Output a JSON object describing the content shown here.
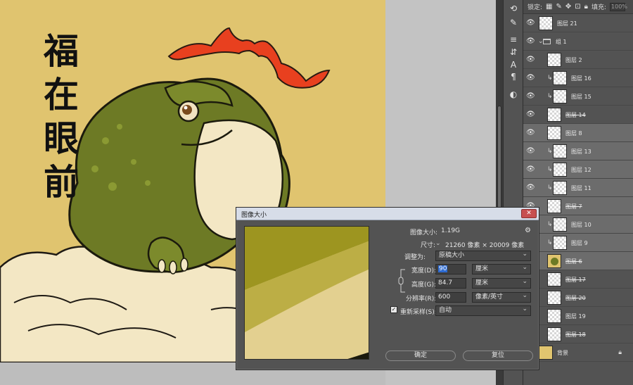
{
  "canvas": {
    "calligraphy": [
      "福",
      "在",
      "眼",
      "前"
    ]
  },
  "lock_bar": {
    "lock_label": "锁定:",
    "fill_label": "填充:",
    "fill_value": "100%"
  },
  "layers": [
    {
      "name": "图层 21",
      "strike": false
    },
    {
      "name": "组 1",
      "folder": true
    },
    {
      "name": "图层 2",
      "strike": false
    },
    {
      "name": "图层 16",
      "strike": false,
      "clipped": true
    },
    {
      "name": "图层 15",
      "strike": false,
      "clipped": true
    },
    {
      "name": "图层 14",
      "strike": true
    },
    {
      "name": "图层 8",
      "strike": false
    },
    {
      "name": "图层 13",
      "strike": false,
      "clipped": true
    },
    {
      "name": "图层 12",
      "strike": false,
      "clipped": true
    },
    {
      "name": "图层 11",
      "strike": false,
      "clipped": true
    },
    {
      "name": "图层 7",
      "strike": true
    },
    {
      "name": "图层 10",
      "strike": false,
      "clipped": true
    },
    {
      "name": "图层 9",
      "strike": false,
      "clipped": true
    },
    {
      "name": "图层 6",
      "strike": true
    },
    {
      "name": "图层 17",
      "strike": true
    },
    {
      "name": "图层 20",
      "strike": true
    },
    {
      "name": "图层 19",
      "strike": false
    },
    {
      "name": "图层 18",
      "strike": true
    },
    {
      "name": "背景",
      "strike": false,
      "locked": true
    }
  ],
  "dialog": {
    "title": "图像大小",
    "close_label": "✕",
    "image_size_label": "图像大小:",
    "image_size_value": "1.19G",
    "dimensions_label": "尺寸:",
    "dimensions_value": "21260 像素 × 20009 像素",
    "fit_to_label": "调整为:",
    "fit_to_value": "原稿大小",
    "width_label": "宽度(D):",
    "width_value": "90",
    "width_unit": "厘米",
    "height_label": "高度(G):",
    "height_value": "84.7",
    "height_unit": "厘米",
    "resolution_label": "分辨率(R):",
    "resolution_value": "600",
    "resolution_unit": "像素/英寸",
    "resample_label": "重新采样(S):",
    "resample_value": "自动",
    "ok_label": "确定",
    "reset_label": "复位"
  },
  "colors": {
    "background_yellow": "#e0c46f",
    "toad_green": "#6d7a25",
    "bat_red": "#e8401f"
  }
}
